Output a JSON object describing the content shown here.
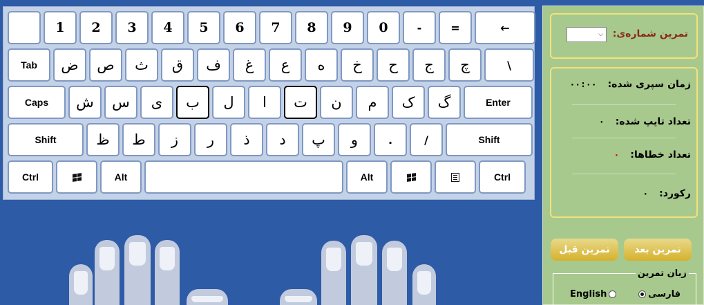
{
  "keyboard": {
    "rows": [
      [
        {
          "label": "",
          "w": 48,
          "kind": "blank"
        },
        {
          "label": "1",
          "kind": "num"
        },
        {
          "label": "2",
          "kind": "num"
        },
        {
          "label": "3",
          "kind": "num"
        },
        {
          "label": "4",
          "kind": "num"
        },
        {
          "label": "5",
          "kind": "num"
        },
        {
          "label": "6",
          "kind": "num"
        },
        {
          "label": "7",
          "kind": "num"
        },
        {
          "label": "8",
          "kind": "num"
        },
        {
          "label": "9",
          "kind": "num"
        },
        {
          "label": "0",
          "kind": "num"
        },
        {
          "label": "-",
          "kind": "sym"
        },
        {
          "label": "=",
          "kind": "sym"
        },
        {
          "label": "←",
          "w": 88,
          "kind": "sym"
        }
      ],
      [
        {
          "label": "Tab",
          "w": 62,
          "kind": "txt"
        },
        {
          "label": "ض",
          "kind": "fa"
        },
        {
          "label": "ص",
          "kind": "fa"
        },
        {
          "label": "ث",
          "kind": "fa"
        },
        {
          "label": "ق",
          "kind": "fa"
        },
        {
          "label": "ف",
          "kind": "fa"
        },
        {
          "label": "غ",
          "kind": "fa"
        },
        {
          "label": "ع",
          "kind": "fa"
        },
        {
          "label": "ه",
          "kind": "fa"
        },
        {
          "label": "خ",
          "kind": "fa"
        },
        {
          "label": "ح",
          "kind": "fa"
        },
        {
          "label": "ج",
          "kind": "fa"
        },
        {
          "label": "چ",
          "kind": "fa"
        },
        {
          "label": "\\",
          "w": 72,
          "kind": "sym"
        }
      ],
      [
        {
          "label": "Caps",
          "w": 84,
          "kind": "txt"
        },
        {
          "label": "ش",
          "kind": "fa"
        },
        {
          "label": "س",
          "kind": "fa"
        },
        {
          "label": "ی",
          "kind": "fa"
        },
        {
          "label": "ب",
          "kind": "fa",
          "highlight": true
        },
        {
          "label": "ل",
          "kind": "fa"
        },
        {
          "label": "ا",
          "kind": "fa"
        },
        {
          "label": "ت",
          "kind": "fa",
          "highlight": true
        },
        {
          "label": "ن",
          "kind": "fa"
        },
        {
          "label": "م",
          "kind": "fa"
        },
        {
          "label": "ک",
          "kind": "fa"
        },
        {
          "label": "گ",
          "kind": "fa"
        },
        {
          "label": "Enter",
          "w": 100,
          "kind": "txt"
        }
      ],
      [
        {
          "label": "Shift",
          "w": 110,
          "kind": "txt"
        },
        {
          "label": "ظ",
          "kind": "fa"
        },
        {
          "label": "ط",
          "kind": "fa"
        },
        {
          "label": "ز",
          "kind": "fa"
        },
        {
          "label": "ر",
          "kind": "fa"
        },
        {
          "label": "ذ",
          "kind": "fa"
        },
        {
          "label": "د",
          "kind": "fa"
        },
        {
          "label": "پ",
          "kind": "fa"
        },
        {
          "label": "و",
          "kind": "fa"
        },
        {
          "label": ".",
          "kind": "sym"
        },
        {
          "label": "/",
          "kind": "sym"
        },
        {
          "label": "Shift",
          "w": 126,
          "kind": "txt"
        }
      ],
      [
        {
          "label": "Ctrl",
          "w": 66,
          "kind": "txt"
        },
        {
          "label": "windows-icon",
          "w": 60,
          "kind": "win"
        },
        {
          "label": "Alt",
          "w": 60,
          "kind": "txt"
        },
        {
          "label": "",
          "w": 288,
          "kind": "blank"
        },
        {
          "label": "Alt",
          "w": 60,
          "kind": "txt"
        },
        {
          "label": "windows-icon",
          "w": 60,
          "kind": "win"
        },
        {
          "label": "menu-icon",
          "w": 60,
          "kind": "menu"
        },
        {
          "label": "Ctrl",
          "w": 68,
          "kind": "txt"
        }
      ]
    ]
  },
  "panel": {
    "exercise_label": "تمرین شماره‌ی:",
    "exercise_select_value": "",
    "stats": [
      {
        "label": "زمان سپری شده:",
        "value": "۰۰:۰۰"
      },
      {
        "label": "تعداد تایپ شده:",
        "value": "۰"
      },
      {
        "label": "تعداد خطاها:",
        "value": "۰",
        "red": true
      },
      {
        "label": "رکورد:",
        "value": "۰"
      }
    ],
    "next_button": "تمرین بعد",
    "prev_button": "تمرین قبل",
    "language_title": "زبان تمرین",
    "language_options": [
      {
        "label": "فارسی",
        "selected": true
      },
      {
        "label": "English",
        "selected": false
      }
    ]
  },
  "colors": {
    "background": "#2d5ba6",
    "panel": "#a8c98e",
    "panel_border": "#f3e27a",
    "button": "#d5b12c",
    "key_border": "#7f98c2"
  }
}
